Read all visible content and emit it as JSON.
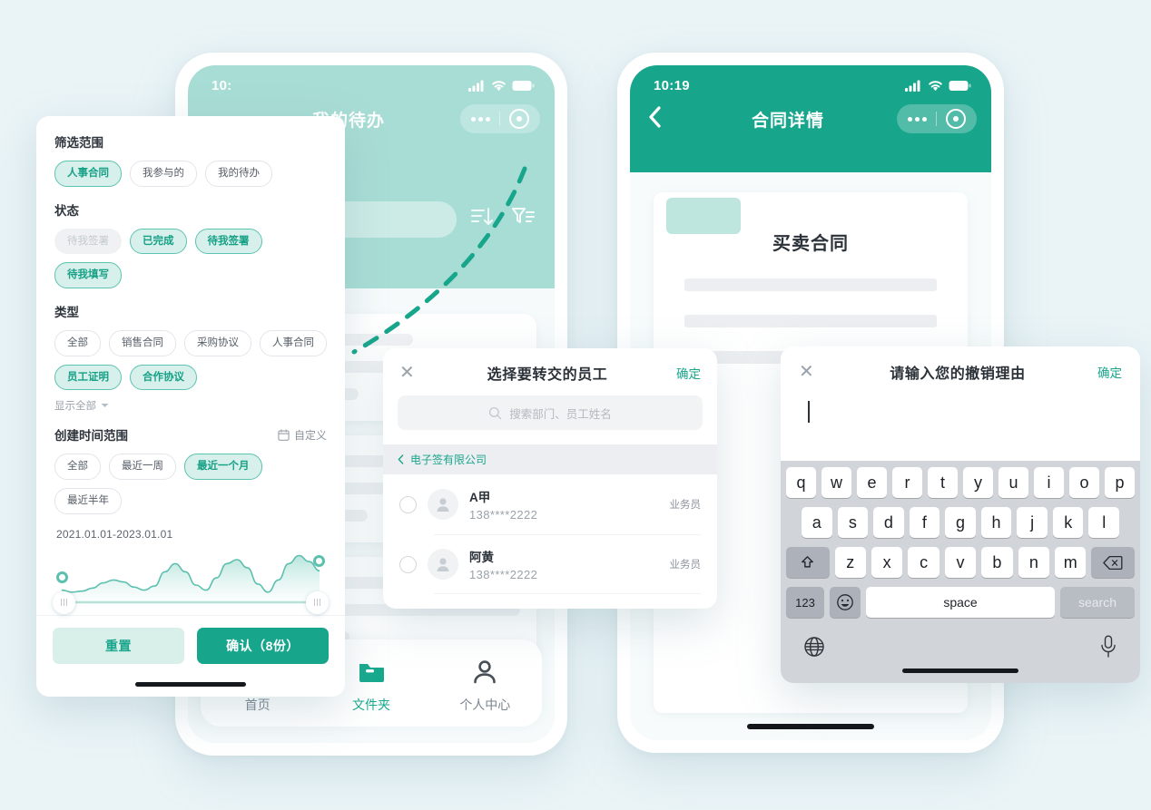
{
  "theme": {
    "page_bg": "#eaf4f7",
    "accent": "#17a68c",
    "accent_light": "#a8ddd5",
    "chip_selected_bg": "#d7f0eb"
  },
  "phone_left": {
    "status_time": "10:",
    "nav_title": "我的待办",
    "bottom_nav": [
      {
        "label": "首页",
        "icon": "home-icon",
        "active": false
      },
      {
        "label": "文件夹",
        "icon": "folder-icon",
        "active": true
      },
      {
        "label": "个人中心",
        "icon": "user-icon",
        "active": false
      }
    ],
    "toolbar_icons": [
      "sort-icon",
      "filter-icon"
    ]
  },
  "phone_right": {
    "status_time": "10:19",
    "nav_title": "合同详情",
    "doc_title": "买卖合同"
  },
  "filter_sheet": {
    "scope": {
      "label": "筛选范围",
      "chips": [
        {
          "label": "人事合同",
          "state": "selected"
        },
        {
          "label": "我参与的",
          "state": "normal"
        },
        {
          "label": "我的待办",
          "state": "normal"
        }
      ]
    },
    "status": {
      "label": "状态",
      "chips": [
        {
          "label": "待我签署",
          "state": "disabled"
        },
        {
          "label": "已完成",
          "state": "selected"
        },
        {
          "label": "待我签署",
          "state": "selected"
        },
        {
          "label": "待我填写",
          "state": "selected"
        }
      ]
    },
    "type": {
      "label": "类型",
      "chips": [
        {
          "label": "全部",
          "state": "normal"
        },
        {
          "label": "销售合同",
          "state": "normal"
        },
        {
          "label": "采购协议",
          "state": "normal"
        },
        {
          "label": "人事合同",
          "state": "normal"
        },
        {
          "label": "员工证明",
          "state": "selected"
        },
        {
          "label": "合作协议",
          "state": "selected"
        }
      ],
      "show_all": "显示全部"
    },
    "time": {
      "label": "创建时间范围",
      "custom_label": "自定义",
      "custom_icon": "calendar-icon",
      "chips": [
        {
          "label": "全部",
          "state": "normal"
        },
        {
          "label": "最近一周",
          "state": "normal"
        },
        {
          "label": "最近一个月",
          "state": "selected"
        },
        {
          "label": "最近半年",
          "state": "normal"
        }
      ],
      "range_text": "2021.01.01-2023.01.01"
    },
    "footer": {
      "reset_label": "重置",
      "confirm_label": "确认（8份）"
    },
    "chart_data": {
      "type": "area",
      "title": "",
      "x": [
        0,
        4,
        8,
        12,
        16,
        20,
        24,
        28,
        32,
        36,
        40,
        44,
        48,
        52,
        56,
        60,
        64,
        68,
        72,
        76,
        80,
        84,
        88,
        92,
        96,
        100
      ],
      "values": [
        12,
        10,
        11,
        14,
        19,
        22,
        20,
        15,
        12,
        16,
        30,
        38,
        30,
        17,
        12,
        24,
        38,
        42,
        34,
        18,
        10,
        22,
        38,
        46,
        40,
        31
      ],
      "ylim": [
        0,
        50
      ],
      "xlabel": "",
      "ylabel": "",
      "grid": false,
      "legend": "none"
    }
  },
  "transfer_sheet": {
    "close_icon": "close-icon",
    "title": "选择要转交的员工",
    "confirm_label": "确定",
    "search_placeholder": "搜索部门、员工姓名",
    "search_icon": "search-icon",
    "breadcrumb": "电子签有限公司",
    "breadcrumb_icon": "chevron-left-icon",
    "employees": [
      {
        "name": "A甲",
        "phone": "138****2222",
        "role": "业务员",
        "selected": false
      },
      {
        "name": "阿黄",
        "phone": "138****2222",
        "role": "业务员",
        "selected": false
      }
    ]
  },
  "keyboard_sheet": {
    "close_icon": "close-icon",
    "title": "请输入您的撤销理由",
    "confirm_label": "确定",
    "input_value": "",
    "rows": {
      "row1": [
        "q",
        "w",
        "e",
        "r",
        "t",
        "y",
        "u",
        "i",
        "o",
        "p"
      ],
      "row2": [
        "a",
        "s",
        "d",
        "f",
        "g",
        "h",
        "j",
        "k",
        "l"
      ],
      "row3": [
        "z",
        "x",
        "c",
        "v",
        "b",
        "n",
        "m"
      ],
      "shift_icon": "shift-icon",
      "backspace_icon": "backspace-icon",
      "num_label": "123",
      "emoji_icon": "emoji-icon",
      "space_label": "space",
      "search_label": "search",
      "globe_icon": "globe-icon",
      "mic_icon": "mic-icon"
    }
  }
}
